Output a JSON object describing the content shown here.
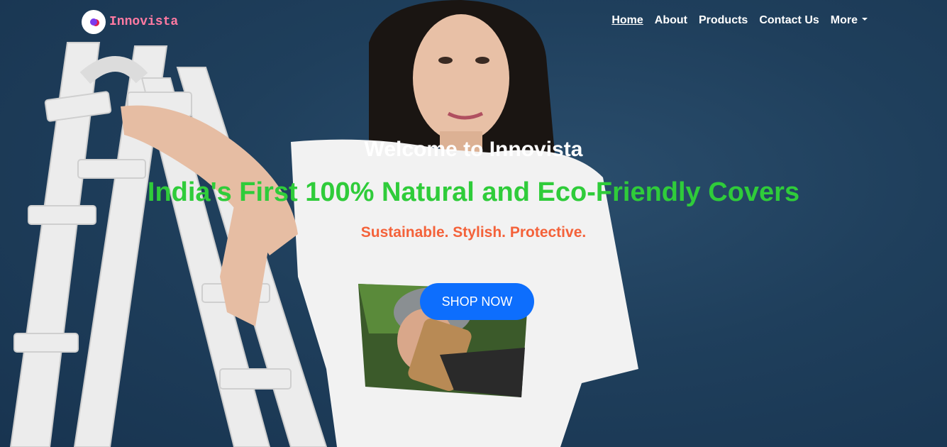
{
  "brand": {
    "name": "Innovista",
    "logo_icon": "innovista-logo-icon"
  },
  "nav": {
    "items": [
      {
        "label": "Home",
        "active": true
      },
      {
        "label": "About",
        "active": false
      },
      {
        "label": "Products",
        "active": false
      },
      {
        "label": "Contact Us",
        "active": false
      },
      {
        "label": "More",
        "active": false,
        "dropdown": true
      }
    ]
  },
  "hero": {
    "welcome": "Welcome to Innovista",
    "tagline": "India's First 100% Natural and Eco-Friendly Covers",
    "subline": "Sustainable. Stylish. Protective.",
    "cta_label": "SHOP NOW"
  },
  "colors": {
    "brand_text": "#ff7aa2",
    "tagline": "#2fcc3a",
    "subline": "#f4623a",
    "cta": "#0d6efd",
    "background": "#1f3f5c"
  }
}
